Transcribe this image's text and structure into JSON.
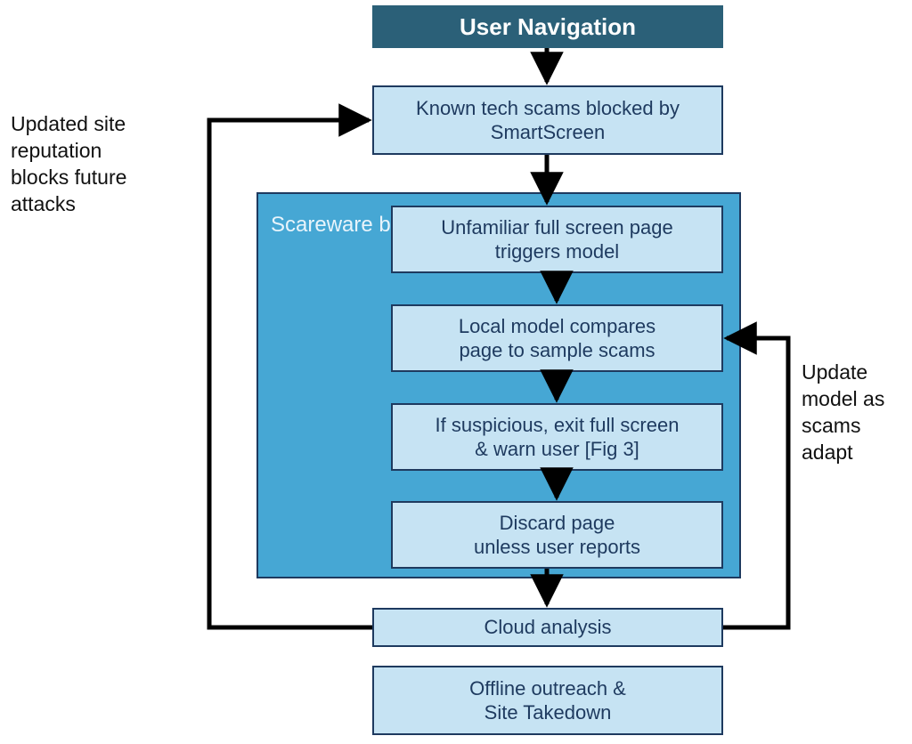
{
  "diagram": {
    "header": "User Navigation",
    "step_smartscreen_l1": "Known tech scams blocked by",
    "step_smartscreen_l2": "SmartScreen",
    "scareware_label_l1": "Scareware",
    "scareware_label_l2": "blocker",
    "step_trigger_l1": "Unfamiliar full screen page",
    "step_trigger_l2": "triggers model",
    "step_compare_l1": "Local model compares",
    "step_compare_l2": "page to sample scams",
    "step_warn_l1": "If suspicious, exit full screen",
    "step_warn_l2": "& warn user [Fig 3]",
    "step_discard_l1": "Discard page",
    "step_discard_l2": "unless user reports",
    "step_cloud": "Cloud analysis",
    "step_offline_l1": "Offline outreach &",
    "step_offline_l2": "Site Takedown",
    "note_left_l1": "Updated site",
    "note_left_l2": "reputation",
    "note_left_l3": "blocks future",
    "note_left_l4": "attacks",
    "note_right_l1": "Update",
    "note_right_l2": "model as",
    "note_right_l3": "scams",
    "note_right_l4": "adapt"
  }
}
